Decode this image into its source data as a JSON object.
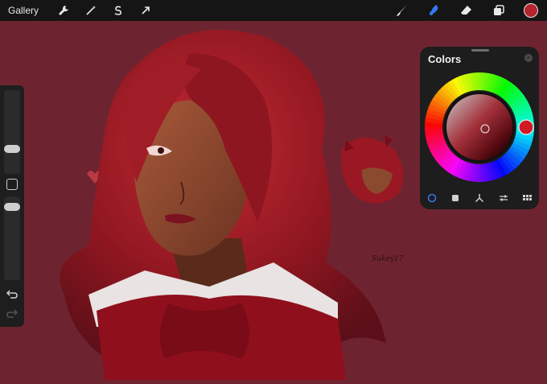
{
  "topbar": {
    "gallery_label": "Gallery",
    "left_tools": [
      "wrench-icon",
      "magic-wand-icon",
      "selection-s-icon",
      "transform-arrow-icon"
    ],
    "right_tools": [
      "brush-icon",
      "smudge-icon",
      "eraser-icon",
      "layers-icon"
    ],
    "active_tool": "smudge-icon",
    "current_color": "#b3242e"
  },
  "colors_panel": {
    "title": "Colors",
    "close_glyph": "×",
    "modes": [
      "disc-mode-icon",
      "classic-mode-icon",
      "harmony-mode-icon",
      "value-mode-icon",
      "palettes-mode-icon"
    ],
    "active_mode": "disc-mode-icon",
    "accent": "#3478f6"
  },
  "sidebar": {
    "controls": [
      "brush-size-slider",
      "modify-button",
      "opacity-slider",
      "undo-icon",
      "redo-icon"
    ]
  },
  "canvas": {
    "background": "#6e2430",
    "signature_text": "Sukey17"
  }
}
